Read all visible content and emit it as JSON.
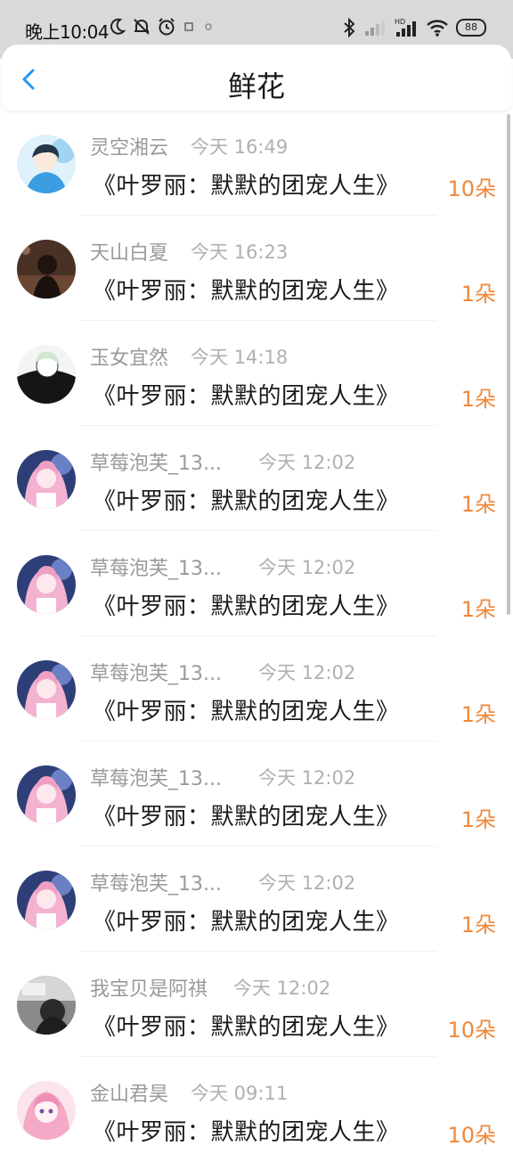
{
  "status_bar": {
    "time": "晚上10:04",
    "battery": "88",
    "network_label": "HD"
  },
  "header": {
    "title": "鲜花",
    "back_icon": "chevron-left-icon"
  },
  "colors": {
    "accent": "#f0883a",
    "back_arrow": "#2196f3",
    "status_bar_bg": "#d9d9d9"
  },
  "items": [
    {
      "username": "灵空湘云",
      "time": "今天 16:49",
      "title": "《叶罗丽：默默的团宠人生》",
      "count": "10朵",
      "avatar_theme": "boy-blue"
    },
    {
      "username": "天山白夏",
      "time": "今天 16:23",
      "title": "《叶罗丽：默默的团宠人生》",
      "count": "1朵",
      "avatar_theme": "dark-brown"
    },
    {
      "username": "玉女宜然",
      "time": "今天 14:18",
      "title": "《叶罗丽：默默的团宠人生》",
      "count": "1朵",
      "avatar_theme": "black-white"
    },
    {
      "username": "草莓泡芙_13...",
      "time": "今天 12:02",
      "title": "《叶罗丽：默默的团宠人生》",
      "count": "1朵",
      "avatar_theme": "pink-anime"
    },
    {
      "username": "草莓泡芙_13...",
      "time": "今天 12:02",
      "title": "《叶罗丽：默默的团宠人生》",
      "count": "1朵",
      "avatar_theme": "pink-anime"
    },
    {
      "username": "草莓泡芙_13...",
      "time": "今天 12:02",
      "title": "《叶罗丽：默默的团宠人生》",
      "count": "1朵",
      "avatar_theme": "pink-anime"
    },
    {
      "username": "草莓泡芙_13...",
      "time": "今天 12:02",
      "title": "《叶罗丽：默默的团宠人生》",
      "count": "1朵",
      "avatar_theme": "pink-anime"
    },
    {
      "username": "草莓泡芙_13...",
      "time": "今天 12:02",
      "title": "《叶罗丽：默默的团宠人生》",
      "count": "1朵",
      "avatar_theme": "pink-anime"
    },
    {
      "username": "我宝贝是阿祺",
      "time": "今天 12:02",
      "title": "《叶罗丽：默默的团宠人生》",
      "count": "10朵",
      "avatar_theme": "gray-photo"
    },
    {
      "username": "金山君昊",
      "time": "今天 09:11",
      "title": "《叶罗丽：默默的团宠人生》",
      "count": "10朵",
      "avatar_theme": "pink-girl"
    }
  ]
}
